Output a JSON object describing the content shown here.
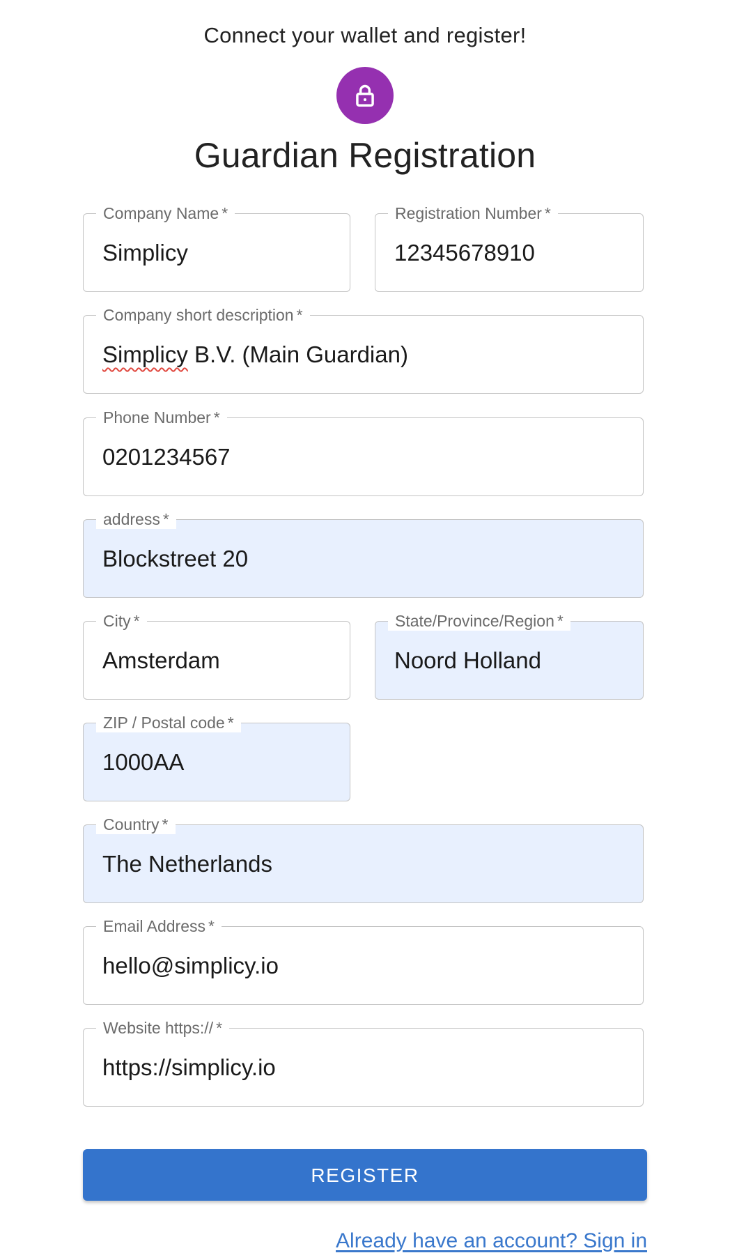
{
  "header": {
    "tagline": "Connect your wallet and register!",
    "avatar_icon": "lock-icon",
    "avatar_color": "#9530b0",
    "title": "Guardian Registration"
  },
  "form": {
    "required_mark": "*",
    "fields": {
      "company_name": {
        "label": "Company Name",
        "value": "Simplicy"
      },
      "registration_number": {
        "label": "Registration Number",
        "value": "12345678910"
      },
      "description": {
        "label": "Company short description",
        "value_word": "Simplicy",
        "value_rest": " B.V. (Main Guardian)"
      },
      "phone": {
        "label": "Phone Number",
        "value": "0201234567"
      },
      "address": {
        "label": "address",
        "value": "Blockstreet 20"
      },
      "city": {
        "label": "City",
        "value": "Amsterdam"
      },
      "state": {
        "label": "State/Province/Region",
        "value": "Noord Holland"
      },
      "zip": {
        "label": "ZIP / Postal code",
        "value": "1000AA"
      },
      "country": {
        "label": "Country",
        "value": "The Netherlands"
      },
      "email": {
        "label": "Email Address",
        "value": "hello@simplicy.io"
      },
      "website": {
        "label": "Website https://",
        "value": "https://simplicy.io"
      }
    },
    "autofill_color": "#e8f0fe"
  },
  "actions": {
    "register_label": "REGISTER",
    "register_color": "#3474cc",
    "signin_link": "Already have an account? Sign in"
  }
}
